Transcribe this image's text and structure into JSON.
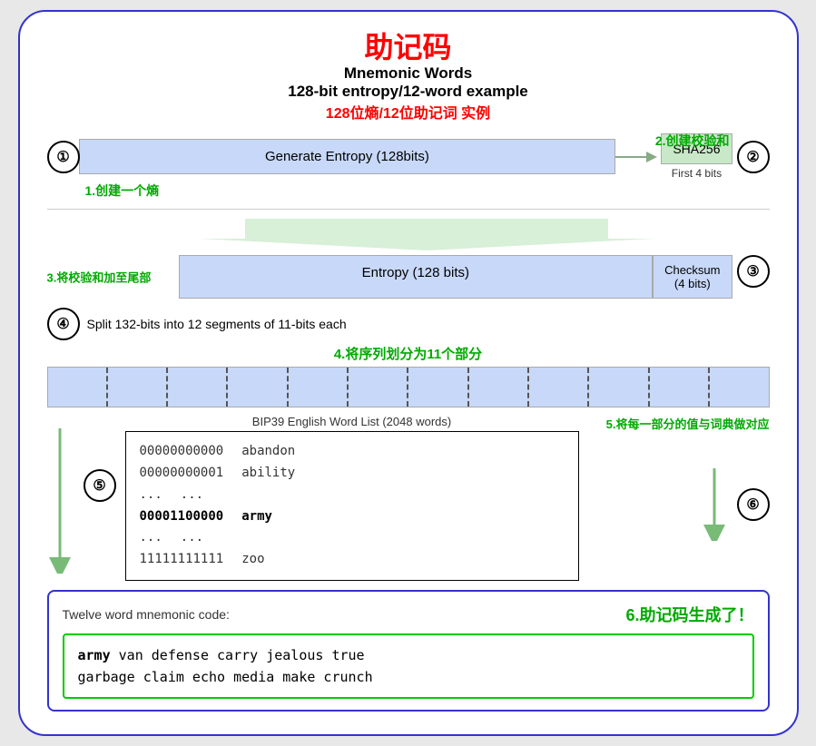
{
  "title": {
    "cn": "助记码",
    "en1": "Mnemonic Words",
    "en2": "128-bit entropy/12-word example",
    "cn_sub": "128位熵/12位助记词 实例"
  },
  "section1": {
    "label_cn": "1.创建一个熵",
    "circle": "①",
    "entropy_text": "Generate Entropy (128bits)"
  },
  "section2": {
    "label_cn": "2.创建校验和",
    "sha_label": "SHA256",
    "first4bits": "First 4 bits",
    "circle": "②"
  },
  "section3": {
    "label_cn": "3.将校验和加至尾部",
    "entropy_text": "Entropy (128 bits)",
    "checksum_text1": "Checksum",
    "checksum_text2": "(4 bits)",
    "circle": "③"
  },
  "section4": {
    "circle": "④",
    "text": "Split 132-bits into 12 segments of 11-bits each",
    "label_cn": "4.将序列划分为11个部分",
    "segments": 12
  },
  "section5": {
    "circle": "⑤",
    "wordlist_label": "BIP39 English Word List (2048 words)",
    "label_cn": "5.将每一部分的值与词典做对应",
    "rows": [
      {
        "num": "00000000000",
        "word": "abandon"
      },
      {
        "num": "00000000001",
        "word": "ability"
      },
      {
        "num": "...",
        "word": "..."
      },
      {
        "num": "00001100000",
        "word": "army",
        "highlight": true
      },
      {
        "num": "...",
        "word": "..."
      },
      {
        "num": "11111111111",
        "word": "zoo"
      }
    ]
  },
  "section6": {
    "circle": "⑥",
    "label_cn": "6.助记码生成了！",
    "output_label": "Twelve word mnemonic code:",
    "mnemonic_first": "army",
    "mnemonic_rest": " van defense carry jealous true\ngarbage claim echo media make crunch"
  }
}
